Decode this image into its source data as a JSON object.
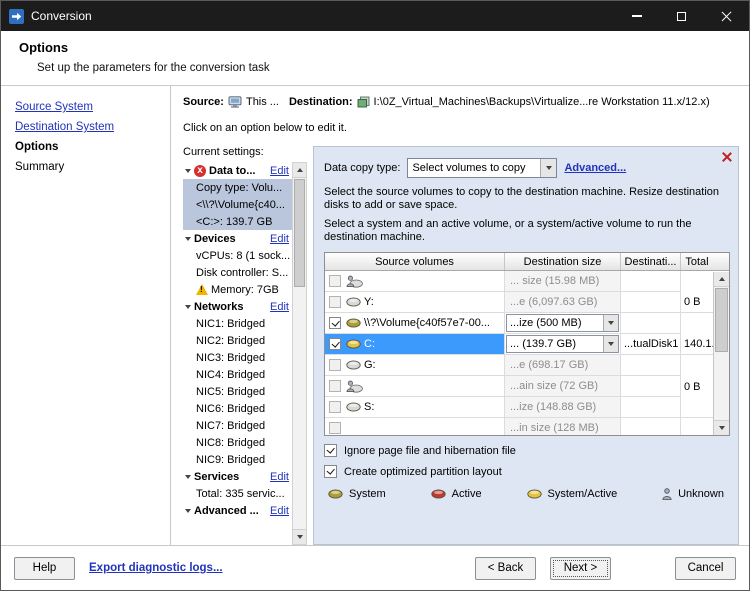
{
  "window": {
    "title": "Conversion"
  },
  "header": {
    "title": "Options",
    "subtitle": "Set up the parameters for the conversion task"
  },
  "sidebar": {
    "items": [
      {
        "label": "Source System",
        "style": "link"
      },
      {
        "label": "Destination System",
        "style": "link"
      },
      {
        "label": "Options",
        "style": "current"
      },
      {
        "label": "Summary",
        "style": "plain"
      }
    ]
  },
  "source_line": {
    "source_label": "Source:",
    "source_icon": "computer-icon",
    "source_value": "This ...",
    "dest_label": "Destination:",
    "dest_icon": "vm-icon",
    "dest_value": "I:\\0Z_Virtual_Machines\\Backups\\Virtualize...re Workstation 11.x/12.x)"
  },
  "instruction": "Click on an option below to edit it.",
  "settings": {
    "title": "Current settings:",
    "items": [
      {
        "label": "Data to...",
        "bold": true,
        "edit": "Edit",
        "icon": "error",
        "expander": true
      },
      {
        "label": "Copy type: Volu...",
        "selected": true
      },
      {
        "label": "<\\\\?\\Volume{c40...",
        "selected": true
      },
      {
        "label": "<C:>: 139.7 GB",
        "selected": true
      },
      {
        "label": "Devices",
        "bold": true,
        "edit": "Edit",
        "expander": true
      },
      {
        "label": "vCPUs: 8 (1 sock..."
      },
      {
        "label": "Disk controller: S..."
      },
      {
        "label": "Memory: 7GB",
        "icon": "warning"
      },
      {
        "label": "Networks",
        "bold": true,
        "edit": "Edit",
        "expander": true
      },
      {
        "label": "NIC1: Bridged"
      },
      {
        "label": "NIC2: Bridged"
      },
      {
        "label": "NIC3: Bridged"
      },
      {
        "label": "NIC4: Bridged"
      },
      {
        "label": "NIC5: Bridged"
      },
      {
        "label": "NIC6: Bridged"
      },
      {
        "label": "NIC7: Bridged"
      },
      {
        "label": "NIC8: Bridged"
      },
      {
        "label": "NIC9: Bridged"
      },
      {
        "label": "Services",
        "bold": true,
        "edit": "Edit",
        "expander": true
      },
      {
        "label": "Total: 335 servic..."
      },
      {
        "label": "Advanced ...",
        "bold": true,
        "edit": "Edit",
        "expander": true
      }
    ]
  },
  "options_panel": {
    "data_copy_label": "Data copy type:",
    "data_copy_value": "Select volumes to copy",
    "advanced_link": "Advanced...",
    "description1": "Select the source volumes to copy to the destination machine. Resize destination disks to add or save space.",
    "description2": "Select a system and an active volume, or a system/active volume to run the destination machine.",
    "table": {
      "columns": [
        "Source volumes",
        "Destination size",
        "Destinati...",
        "Total"
      ],
      "rows": [
        {
          "checked": false,
          "grayed": true,
          "icon": "unknown-disk",
          "label": "",
          "dest_size": "... size (15.98 MB)",
          "size_type": "text",
          "dest": "",
          "total": ""
        },
        {
          "checked": false,
          "grayed": true,
          "icon": "disk",
          "label": "Y:",
          "dest_size": "...e (6,097.63 GB)",
          "size_type": "text",
          "dest": "",
          "total": "0 B"
        },
        {
          "checked": true,
          "grayed": false,
          "icon": "system-disk",
          "label": "\\\\?\\Volume{c40f57e7-00...",
          "dest_size": "...ize (500 MB)",
          "size_type": "dropdown",
          "dest": "",
          "total": ""
        },
        {
          "checked": true,
          "grayed": false,
          "selected": true,
          "icon": "sysactive-disk",
          "label": "C:",
          "dest_size": "... (139.7 GB)",
          "size_type": "dropdown",
          "dest": "...tualDisk1",
          "total": "140.1..."
        },
        {
          "checked": false,
          "grayed": true,
          "icon": "disk",
          "label": "G:",
          "dest_size": "...e (698.17 GB)",
          "size_type": "text",
          "dest": "",
          "total": ""
        },
        {
          "checked": false,
          "grayed": true,
          "icon": "unknown-disk",
          "label": "",
          "dest_size": "...ain size (72 GB)",
          "size_type": "text",
          "dest": "",
          "total": "0 B"
        },
        {
          "checked": false,
          "grayed": true,
          "icon": "disk",
          "label": "S:",
          "dest_size": "...ize (148.88 GB)",
          "size_type": "text",
          "dest": "",
          "total": ""
        },
        {
          "checked": false,
          "grayed": true,
          "icon": "",
          "label": "",
          "dest_size": "...in size (128 MB)",
          "size_type": "text",
          "dest": "",
          "total": ""
        }
      ]
    },
    "checkboxes": [
      {
        "label": "Ignore page file and hibernation file",
        "checked": true
      },
      {
        "label": "Create optimized partition layout",
        "checked": true
      }
    ],
    "legend": [
      {
        "label": "System",
        "icon": "system-disk-icon"
      },
      {
        "label": "Active",
        "icon": "active-disk-icon"
      },
      {
        "label": "System/Active",
        "icon": "system-active-disk-icon"
      },
      {
        "label": "Unknown",
        "icon": "unknown-person-icon"
      }
    ]
  },
  "footer": {
    "help": "Help",
    "export_link": "Export diagnostic logs...",
    "back": "< Back",
    "next": "Next >",
    "cancel": "Cancel"
  },
  "colors": {
    "titlebar": "#1c1c1c",
    "link": "#2233bb",
    "panel_bg": "#dde6f2",
    "selected_row": "#3d9afd",
    "tree_selected": "#b9c6dc"
  }
}
